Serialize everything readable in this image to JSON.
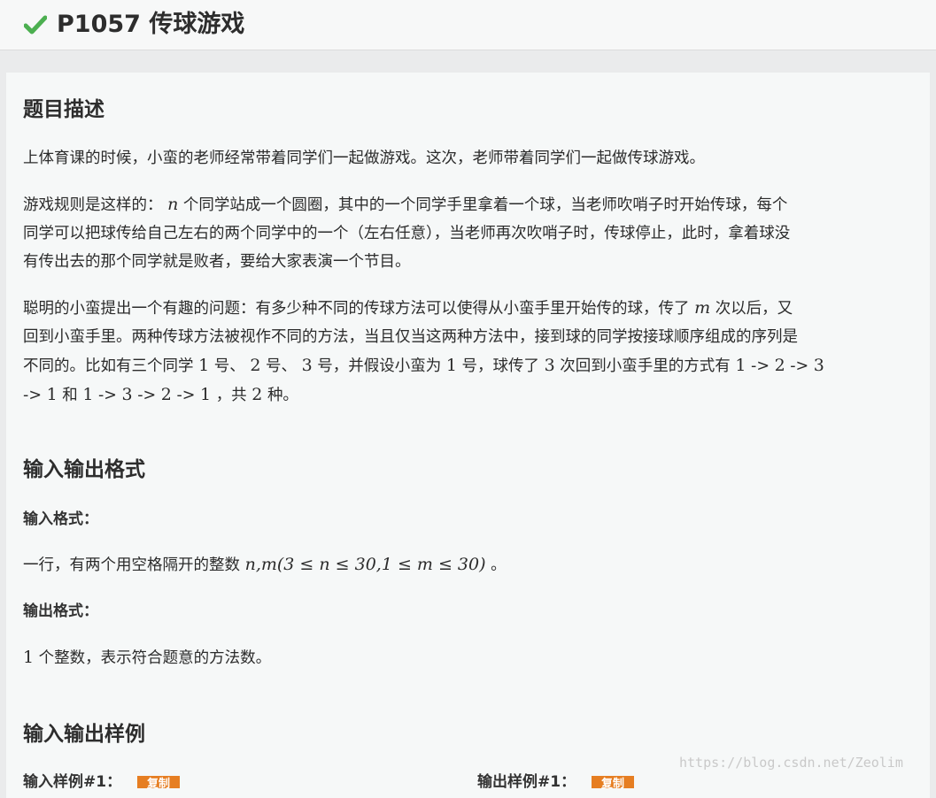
{
  "header": {
    "problem_id": "P1057",
    "problem_name": "传球游戏",
    "status_icon": "check-icon",
    "status_color": "#4caf50"
  },
  "description": {
    "heading": "题目描述",
    "para1": "上体育课的时候，小蛮的老师经常带着同学们一起做游戏。这次，老师带着同学们一起做传球游戏。",
    "para2_lines": [
      "游戏规则是这样的：",
      "个同学站成一个圆圈，其中的一个同学手里拿着一个球，当老师吹哨子时开始传球，每个",
      "同学可以把球传给自己左右的两个同学中的一个（左右任意），当老师再次吹哨子时，传球停止，此时，拿着球没",
      "有传出去的那个同学就是败者，要给大家表演一个节目。"
    ],
    "var_n": "n",
    "var_m": "m",
    "para3_lines": [
      "聪明的小蛮提出一个有趣的问题：有多少种不同的传球方法可以使得从小蛮手里开始传的球，传了",
      "次以后，又",
      "回到小蛮手里。两种传球方法被视作不同的方法，当且仅当这两种方法中，接到球的同学按接球顺序组成的序列是",
      "不同的。比如有三个同学",
      "号、",
      "号、",
      "号，并假设小蛮为",
      "号，球传了",
      "次回到小蛮手里的方式有",
      "和",
      "，共",
      "种。"
    ],
    "num_1": "1",
    "num_2": "2",
    "num_3": "3",
    "arrow": "->"
  },
  "io_format": {
    "heading": "输入输出格式",
    "input_label": "输入格式：",
    "input_text_pre": "一行，有两个用空格隔开的整数",
    "input_math": "n,m(3 ≤ n ≤ 30,1 ≤ m ≤ 30)",
    "input_text_post": "。",
    "output_label": "输出格式：",
    "output_math": "1",
    "output_text": "个整数，表示符合题意的方法数。"
  },
  "samples": {
    "heading": "输入输出样例",
    "input_label": "输入样例#1：",
    "output_label": "输出样例#1：",
    "copy_label": "复制",
    "copy_color": "#e67e22"
  },
  "watermark": "https://blog.csdn.net/Zeolim"
}
